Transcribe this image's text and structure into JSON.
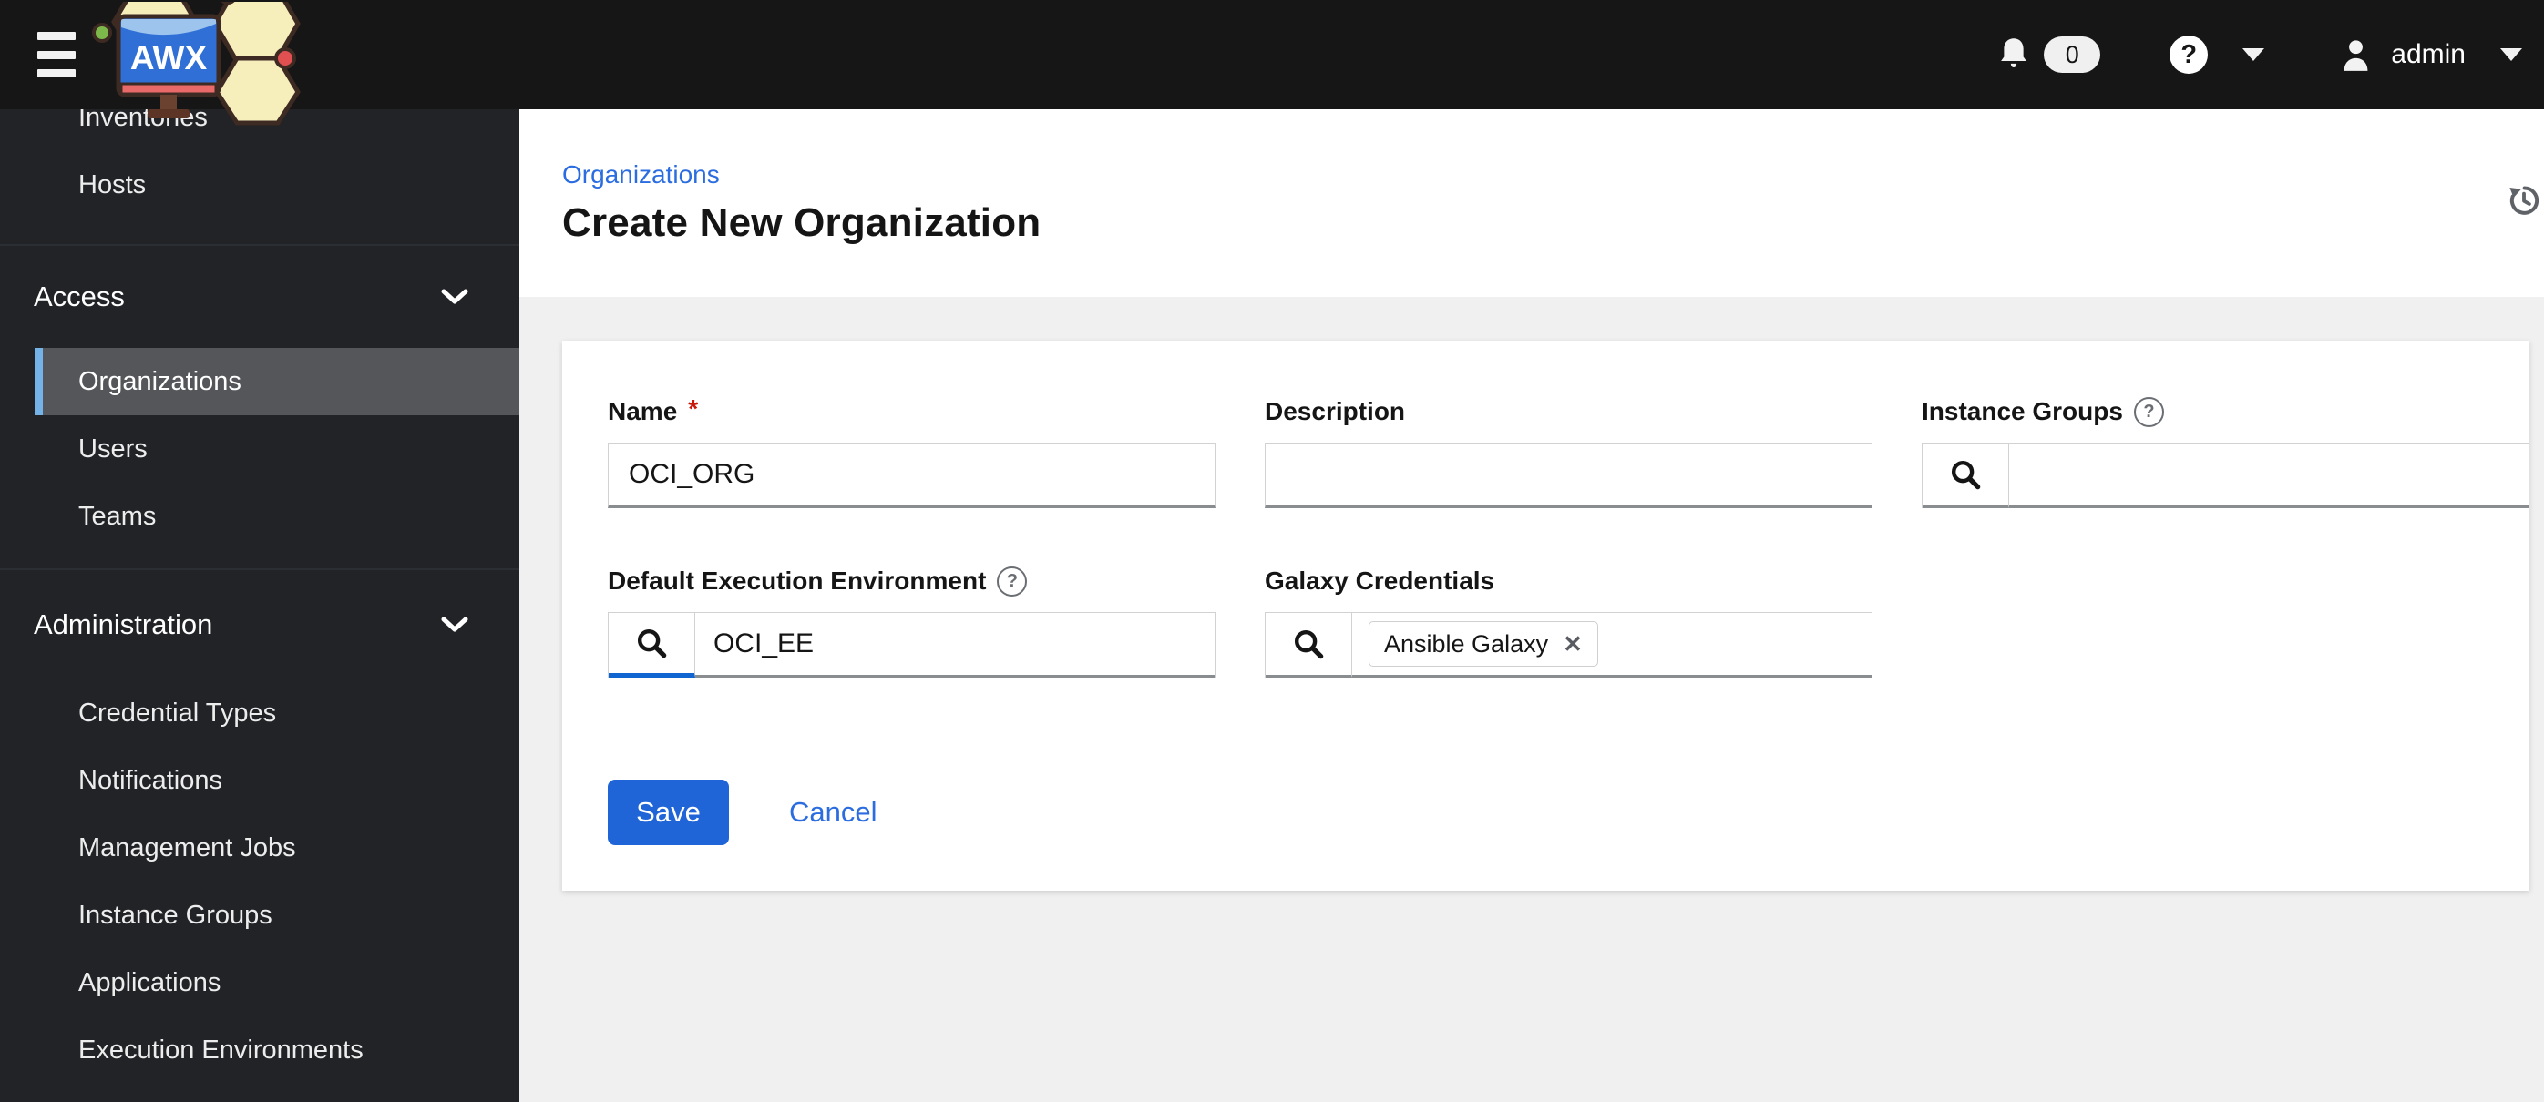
{
  "masthead": {
    "brand": "AWX",
    "notifications_count": "0",
    "user": "admin"
  },
  "sidebar": {
    "top_items": [
      {
        "label": "Inventories"
      },
      {
        "label": "Hosts"
      }
    ],
    "groups": [
      {
        "label": "Access",
        "items": [
          {
            "label": "Organizations",
            "selected": true
          },
          {
            "label": "Users"
          },
          {
            "label": "Teams"
          }
        ]
      },
      {
        "label": "Administration",
        "items": [
          {
            "label": "Credential Types"
          },
          {
            "label": "Notifications"
          },
          {
            "label": "Management Jobs"
          },
          {
            "label": "Instance Groups"
          },
          {
            "label": "Applications"
          },
          {
            "label": "Execution Environments"
          }
        ]
      }
    ]
  },
  "page": {
    "breadcrumb": "Organizations",
    "title": "Create New Organization"
  },
  "form": {
    "fields": {
      "name": {
        "label": "Name",
        "required": true,
        "value": "OCI_ORG"
      },
      "description": {
        "label": "Description",
        "value": ""
      },
      "instance_groups": {
        "label": "Instance Groups",
        "value": ""
      },
      "default_execution_environment": {
        "label": "Default Execution Environment",
        "value": "OCI_EE"
      },
      "galaxy_credentials": {
        "label": "Galaxy Credentials",
        "chips": [
          {
            "label": "Ansible Galaxy"
          }
        ]
      }
    },
    "actions": {
      "save": "Save",
      "cancel": "Cancel"
    }
  },
  "icons": {
    "required": "*",
    "help": "?",
    "close": "✕"
  },
  "colors": {
    "masthead_bg": "#161616",
    "sidebar_bg": "#212327",
    "selected_item_bg": "#54565a",
    "selected_item_bar": "#73b3e8",
    "link_blue": "#2b6de0",
    "primary_button": "#2065d8",
    "active_addon_underline": "#1065d1",
    "required_red": "#c9190b",
    "page_bg": "#f0f0f0",
    "input_border": "#d2d2d2",
    "input_bottom_border": "#8a8d90",
    "help_gray": "#6a6e73"
  }
}
